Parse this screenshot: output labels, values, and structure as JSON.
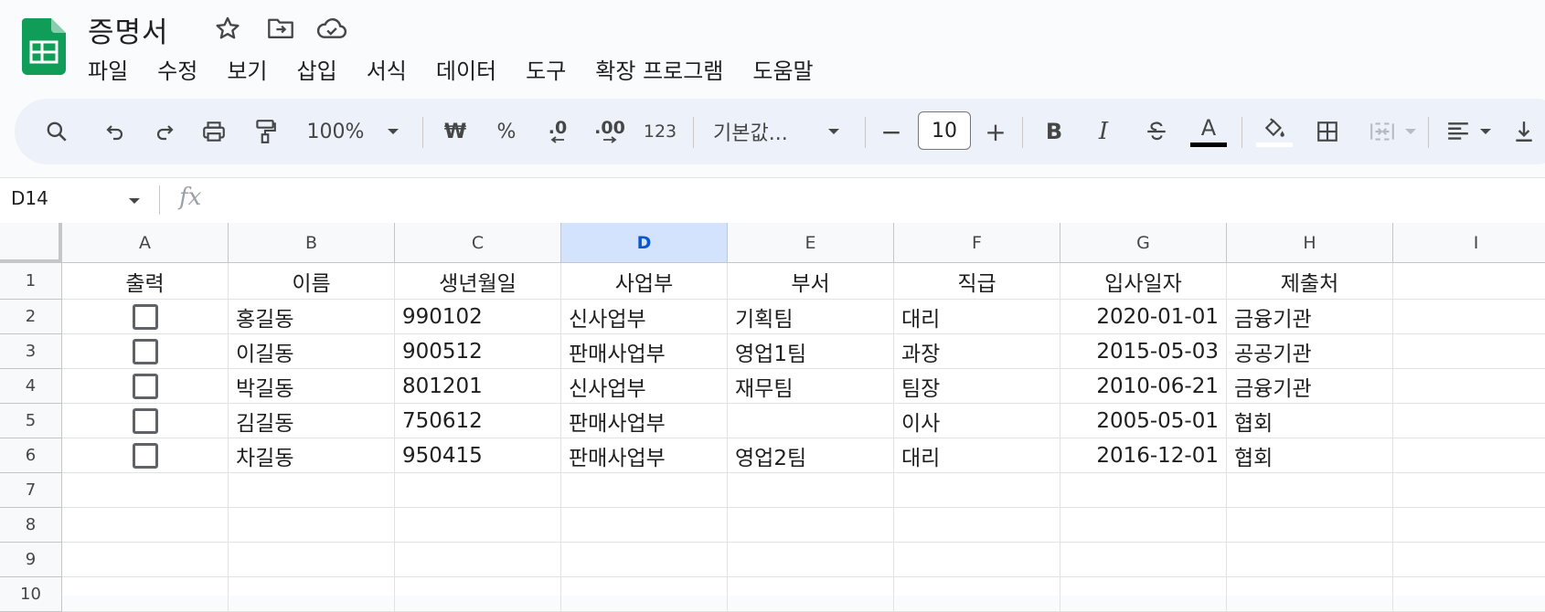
{
  "app": {
    "doc_title": "증명서",
    "brand_color": "#0f9d58",
    "icons": [
      "star-icon",
      "move-to-folder-icon",
      "cloud-saved-icon"
    ]
  },
  "menu": [
    "파일",
    "수정",
    "보기",
    "삽입",
    "서식",
    "데이터",
    "도구",
    "확장 프로그램",
    "도움말"
  ],
  "toolbar": {
    "zoom": "100%",
    "currency": "₩",
    "percent": "%",
    "decimal_decrease": ".0",
    "decimal_increase": ".00",
    "number_format": "123",
    "font": "기본값...",
    "font_size": "10",
    "minus": "−",
    "plus": "+",
    "bold": "B",
    "italic": "I",
    "text_color_label": "A"
  },
  "formula_bar": {
    "name_box": "D14",
    "fx": "fx"
  },
  "sheet": {
    "columns": [
      "A",
      "B",
      "C",
      "D",
      "E",
      "F",
      "G",
      "H",
      "I"
    ],
    "selected_column": "D",
    "row_numbers": [
      "1",
      "2",
      "3",
      "4",
      "5",
      "6",
      "7",
      "8",
      "9",
      "10"
    ],
    "headers": [
      "출력",
      "이름",
      "생년월일",
      "사업부",
      "부서",
      "직급",
      "입사일자",
      "제출처"
    ],
    "rows": [
      {
        "checked": false,
        "name": "홍길동",
        "birth": "990102",
        "division": "신사업부",
        "dept": "기획팀",
        "rank": "대리",
        "hire_date": "2020-01-01",
        "submit_to": "금융기관"
      },
      {
        "checked": false,
        "name": "이길동",
        "birth": "900512",
        "division": "판매사업부",
        "dept": "영업1팀",
        "rank": "과장",
        "hire_date": "2015-05-03",
        "submit_to": "공공기관"
      },
      {
        "checked": false,
        "name": "박길동",
        "birth": "801201",
        "division": "신사업부",
        "dept": "재무팀",
        "rank": "팀장",
        "hire_date": "2010-06-21",
        "submit_to": "금융기관"
      },
      {
        "checked": false,
        "name": "김길동",
        "birth": "750612",
        "division": "판매사업부",
        "dept": "",
        "rank": "이사",
        "hire_date": "2005-05-01",
        "submit_to": "협회"
      },
      {
        "checked": false,
        "name": "차길동",
        "birth": "950415",
        "division": "판매사업부",
        "dept": "영업2팀",
        "rank": "대리",
        "hire_date": "2016-12-01",
        "submit_to": "협회"
      }
    ]
  }
}
